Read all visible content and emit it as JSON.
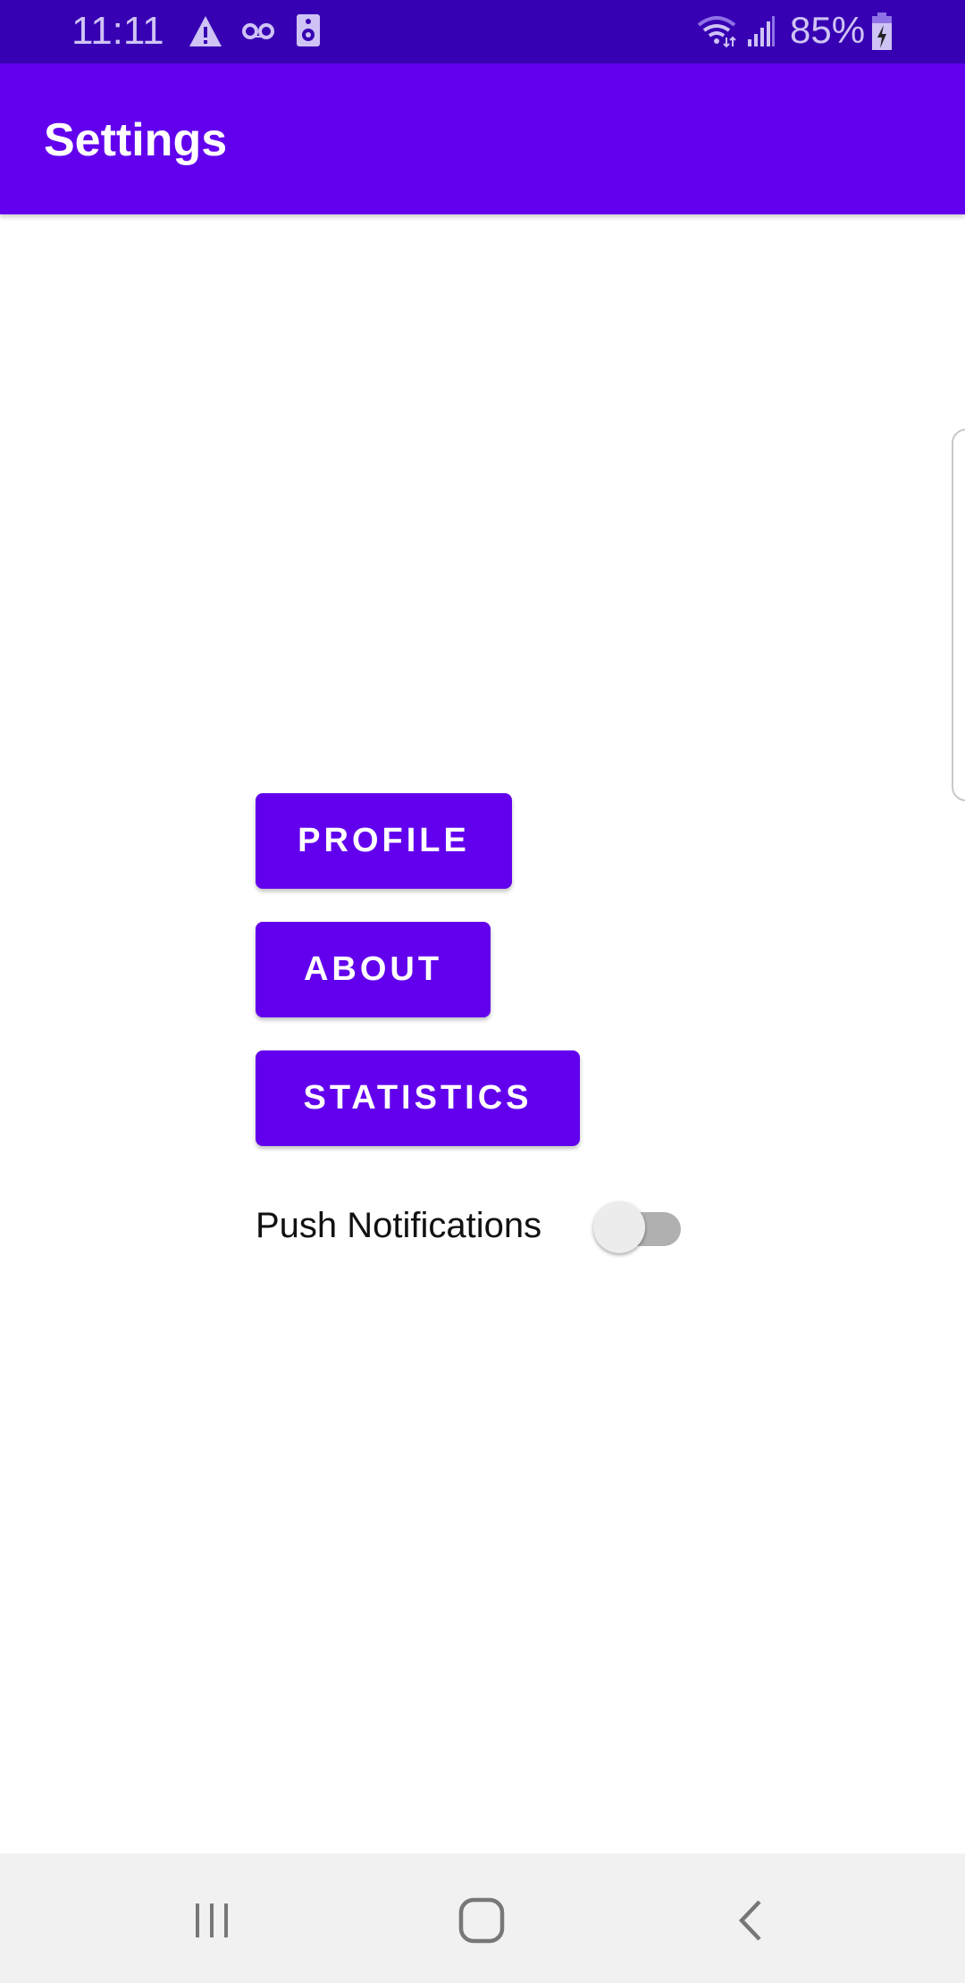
{
  "status_bar": {
    "time": "11:11",
    "battery_percent": "85%",
    "icons": [
      "warning-icon",
      "voicemail-icon",
      "speaker-icon",
      "wifi-icon",
      "signal-icon",
      "battery-charging-icon"
    ]
  },
  "app_bar": {
    "title": "Settings"
  },
  "buttons": {
    "profile": "PROFILE",
    "about": "ABOUT",
    "statistics": "STATISTICS"
  },
  "push_notifications": {
    "label": "Push Notifications",
    "enabled": false
  },
  "colors": {
    "primary": "#6200ee",
    "primary_dark": "#3700b3"
  },
  "nav_bar": {
    "icons": [
      "recents-icon",
      "home-icon",
      "back-icon"
    ]
  }
}
